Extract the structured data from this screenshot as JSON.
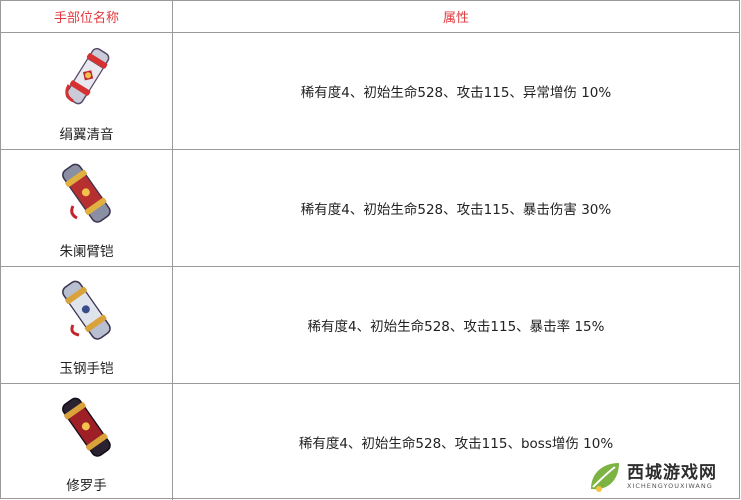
{
  "header": {
    "name_col": "手部位名称",
    "attr_col": "属性"
  },
  "items": [
    {
      "name": "绢翼清音",
      "attributes": "稀有度4、初始生命528、攻击115、异常增伤 10%",
      "icon": "scroll-gauntlet-icon-red"
    },
    {
      "name": "朱阑臂铠",
      "attributes": "稀有度4、初始生命528、攻击115、暴击伤害 30%",
      "icon": "armored-gauntlet-icon-crimson"
    },
    {
      "name": "玉钢手铠",
      "attributes": "稀有度4、初始生命528、攻击115、暴击率 15%",
      "icon": "armored-gauntlet-icon-steel"
    },
    {
      "name": "修罗手",
      "attributes": "稀有度4、初始生命528、攻击115、boss增伤 10%",
      "icon": "armored-gauntlet-icon-dark"
    }
  ],
  "watermark": {
    "title": "西城游戏网",
    "subtitle": "XICHENGYOUXIWANG",
    "logo": "leaf-logo-icon"
  },
  "colors": {
    "header_text": "#e0393e",
    "border": "#9a9a9a",
    "logo_green": "#7cb342"
  }
}
